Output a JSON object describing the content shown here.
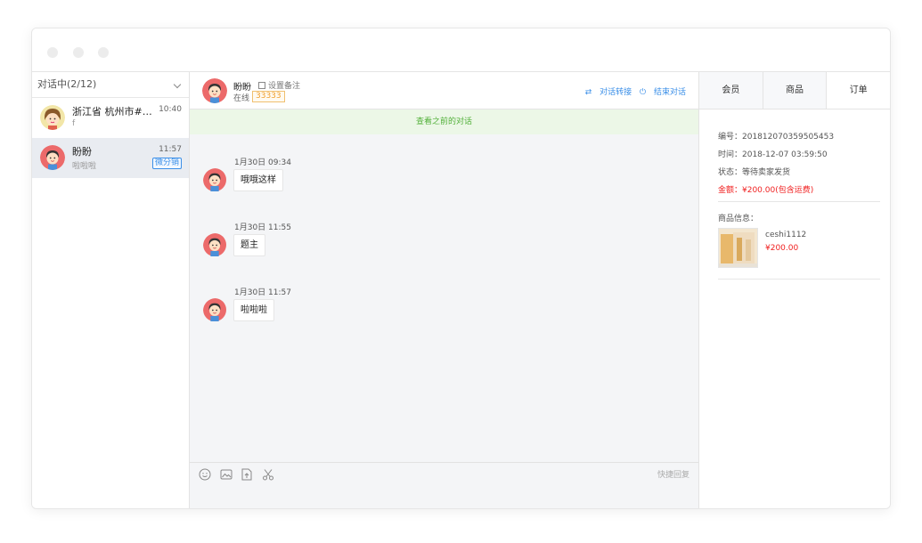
{
  "sessions": {
    "header": "对话中(2/12)",
    "items": [
      {
        "name": "浙江省 杭州市#20...",
        "preview": "f",
        "time": "10:40",
        "tag": ""
      },
      {
        "name": "盼盼",
        "preview": "啦啦啦",
        "time": "11:57",
        "tag": "微分销"
      }
    ]
  },
  "chat": {
    "contact_name": "盼盼",
    "remark_label": "设置备注",
    "status": "在线",
    "contact_id": "33333",
    "transfer_label": "对话转接",
    "end_label": "结束对话",
    "history_label": "查看之前的对话",
    "messages": [
      {
        "time": "1月30日 09:34",
        "text": "哦哦这样"
      },
      {
        "time": "1月30日 11:55",
        "text": "题主"
      },
      {
        "time": "1月30日 11:57",
        "text": "啦啦啦"
      }
    ],
    "quick_reply_label": "快捷回复",
    "tools": [
      "emoji-icon",
      "image-icon",
      "file-upload-icon",
      "scissors-icon"
    ]
  },
  "panel": {
    "tabs": [
      "会员",
      "商品",
      "订单"
    ],
    "active_tab": "订单",
    "order": {
      "number": "编号：201812070359505453",
      "time": "时间：2018-12-07 03:59:50",
      "state": "状态：等待卖家发货",
      "amount": "金额：¥200.00(包含运费)"
    },
    "goods_title": "商品信息：",
    "goods_name": "ceshi1112",
    "goods_price": "¥200.00"
  },
  "colors": {
    "accent_blue": "#3b8fe8",
    "history_green": "#52b03a",
    "price_red": "#f02020",
    "id_orange": "#f0a030"
  }
}
